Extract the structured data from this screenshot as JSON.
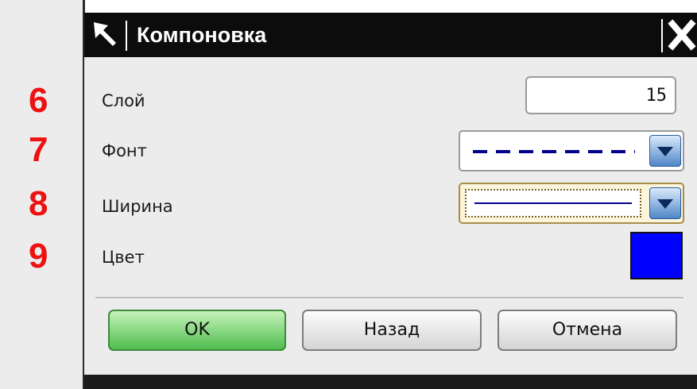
{
  "steps": {
    "layer": "6",
    "font": "7",
    "width": "8",
    "color": "9"
  },
  "dialog": {
    "title": "Компоновка",
    "title_icon": "pin-icon",
    "close_icon": "close-icon"
  },
  "fields": {
    "layer": {
      "label": "Слой",
      "value": "15"
    },
    "font": {
      "label": "Фонт",
      "value_icon": "dashed-line-icon"
    },
    "width": {
      "label": "Ширина",
      "value_icon": "thin-line-icon"
    },
    "color": {
      "label": "Цвет",
      "value": "#0000ff"
    }
  },
  "buttons": {
    "ok": "OK",
    "back": "Назад",
    "cancel": "Отмена"
  },
  "colors": {
    "step_number": "#ee1111",
    "title_bar": "#0c0c0c",
    "line_style": "#00008b",
    "ok_button": "#4fbd4f"
  }
}
